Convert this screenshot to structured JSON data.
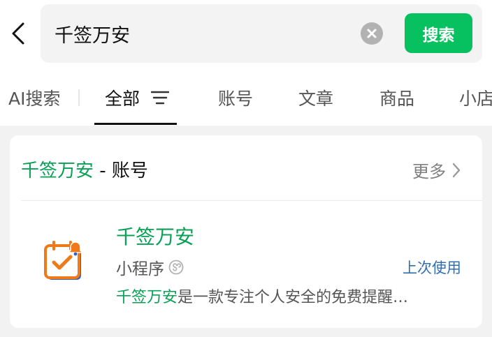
{
  "search": {
    "value": "千签万安",
    "button_label": "搜索"
  },
  "tabs": [
    {
      "label": "AI搜索"
    },
    {
      "label": "全部"
    },
    {
      "label": "账号"
    },
    {
      "label": "文章"
    },
    {
      "label": "商品"
    },
    {
      "label": "小店"
    }
  ],
  "section": {
    "highlight": "千签万安",
    "suffix": " - 账号",
    "more_label": "更多"
  },
  "result": {
    "name": "千签万安",
    "type": "小程序",
    "recent_label": "上次使用",
    "desc_highlight": "千签万安",
    "desc_rest": "是一款专注个人安全的免费提醒…"
  },
  "colors": {
    "brand_green": "#07c160",
    "highlight_green": "#07a155",
    "link_blue": "#2f6fb3",
    "logo_orange": "#f07a1a",
    "logo_blue": "#2e63c9"
  },
  "icons": {
    "back": "chevron-left-icon",
    "clear": "close-circle-icon",
    "filter": "filter-icon",
    "more": "chevron-right-icon",
    "mini_program": "mini-program-icon",
    "logo": "calendar-check-icon"
  }
}
